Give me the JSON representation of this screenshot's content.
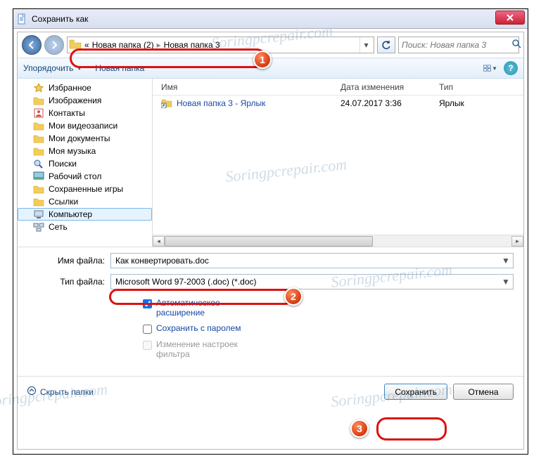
{
  "window": {
    "title": "Сохранить как"
  },
  "nav": {
    "breadcrumb": {
      "prefix": "«",
      "part1": "Новая папка (2)",
      "part2": "Новая папка 3"
    },
    "search_placeholder": "Поиск: Новая папка 3"
  },
  "toolbar": {
    "organize": "Упорядочить",
    "new_folder": "Новая папка"
  },
  "sidebar": {
    "items": [
      {
        "label": "Избранное",
        "kind": "star"
      },
      {
        "label": "Изображения",
        "kind": "folder"
      },
      {
        "label": "Контакты",
        "kind": "contacts"
      },
      {
        "label": "Мои видеозаписи",
        "kind": "folder"
      },
      {
        "label": "Мои документы",
        "kind": "folder"
      },
      {
        "label": "Моя музыка",
        "kind": "folder"
      },
      {
        "label": "Поиски",
        "kind": "search"
      },
      {
        "label": "Рабочий стол",
        "kind": "desktop"
      },
      {
        "label": "Сохраненные игры",
        "kind": "folder"
      },
      {
        "label": "Ссылки",
        "kind": "folder"
      },
      {
        "label": "Компьютер",
        "kind": "computer",
        "selected": true
      },
      {
        "label": "Сеть",
        "kind": "network"
      }
    ]
  },
  "filelist": {
    "columns": {
      "name": "Имя",
      "date": "Дата изменения",
      "type": "Тип"
    },
    "rows": [
      {
        "name": "Новая папка 3 - Ярлык",
        "date": "24.07.2017 3:36",
        "type": "Ярлык"
      }
    ]
  },
  "form": {
    "filename_label": "Имя файла:",
    "filename_value": "Как конвертировать.doc",
    "filetype_label": "Тип файла:",
    "filetype_value": "Microsoft Word 97-2003 (.doc) (*.doc)",
    "auto_ext": "Автоматическое расширение",
    "with_password": "Сохранить с паролем",
    "filter_settings": "Изменение настроек фильтра"
  },
  "footer": {
    "hide_folders": "Скрыть папки",
    "save": "Сохранить",
    "cancel": "Отмена"
  },
  "badges": {
    "b1": "1",
    "b2": "2",
    "b3": "3"
  },
  "watermark": "Soringpcrepair.com"
}
